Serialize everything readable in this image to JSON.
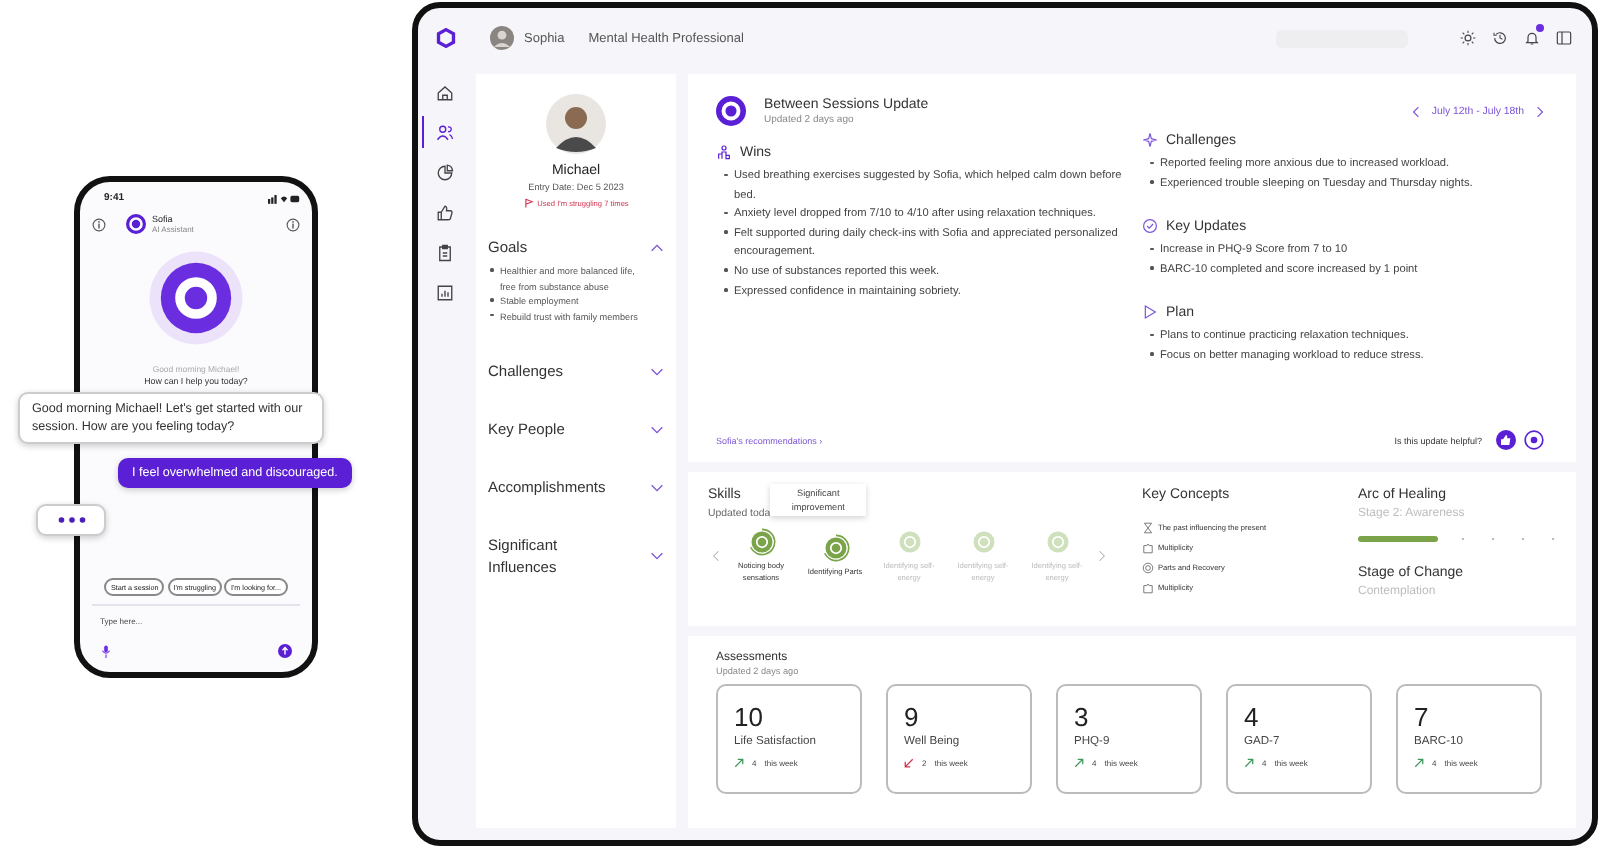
{
  "phone": {
    "time": "9:41",
    "assistant_name": "Sofia",
    "assistant_role": "AI Assistant",
    "greeting": "Good morning Michael!",
    "prompt": "How can I help you today?",
    "chips": [
      "Start a session",
      "I'm struggling",
      "I'm looking for..."
    ],
    "input": {
      "placeholder": "Type here..."
    }
  },
  "chat": [
    {
      "kind": "bot",
      "text": "Good morning Michael! Let's get started with our session.  How are you feeling today?"
    },
    {
      "kind": "user",
      "text": "I feel overwhelmed and discouraged."
    },
    {
      "kind": "typing"
    }
  ],
  "top_bar": {
    "user": "Sophia",
    "role": "Mental Health Professional",
    "notification": true
  },
  "nav_rail": [
    {
      "kind": "home",
      "selected": false
    },
    {
      "kind": "people",
      "selected": true
    },
    {
      "kind": "chart",
      "selected": false
    },
    {
      "kind": "thumbs",
      "selected": false
    },
    {
      "kind": "clipboard",
      "selected": false
    },
    {
      "kind": "report",
      "selected": false
    }
  ],
  "profile": {
    "name": "Michael",
    "entry_date": "Entry Date: Dec 5 2023",
    "alert": "Used I'm struggling 7 times",
    "sections": [
      {
        "title": "Goals",
        "expanded": true,
        "items": [
          "Healthier and more balanced life, free from substance abuse",
          "Stable employment",
          "Rebuild trust with family members"
        ]
      },
      {
        "title": "Challenges",
        "expanded": false
      },
      {
        "title": "Key People",
        "expanded": false
      },
      {
        "title": "Accomplishments",
        "expanded": false
      },
      {
        "title": "Significant Influences",
        "expanded": false
      }
    ]
  },
  "update": {
    "title": "Between Sessions Update",
    "updated": "Updated 2 days ago",
    "date_range": "July 12th - July 18th",
    "sections": [
      {
        "kind": "wins",
        "title": "Wins",
        "items": [
          "Used breathing exercises suggested by Sofia, which helped calm down before bed.",
          "Anxiety level dropped from 7/10 to 4/10 after using relaxation techniques.",
          "Felt supported during daily check-ins with Sofia and appreciated personalized encouragement.",
          "No use of substances reported this week.",
          "Expressed confidence in maintaining sobriety."
        ]
      },
      {
        "kind": "challenges",
        "title": "Challenges",
        "items": [
          "Reported feeling more anxious due to increased workload.",
          "Experienced trouble sleeping on Tuesday and Thursday nights."
        ]
      },
      {
        "kind": "key_updates",
        "title": "Key Updates",
        "items": [
          "Increase in PHQ-9 Score from 7 to 10",
          "BARC-10 completed and score increased by 1 point"
        ]
      },
      {
        "kind": "plan",
        "title": "Plan",
        "items": [
          "Plans to continue practicing relaxation techniques.",
          "Focus on better managing workload to reduce stress."
        ]
      }
    ],
    "recommendations_link": "Sofia's recommendations ›",
    "feedback_prompt": "Is this update helpful?"
  },
  "skills": {
    "title": "Skills",
    "updated": "Updated toda",
    "tooltip": "Significant improvement",
    "items": [
      {
        "label": "Noticing body sensations",
        "achieved": true
      },
      {
        "label": "Identifying Parts",
        "achieved": true
      },
      {
        "label": "Identifying self-energy",
        "achieved": false
      },
      {
        "label": "Identifying self-energy",
        "achieved": false
      },
      {
        "label": "Identifying self-energy",
        "achieved": false
      }
    ]
  },
  "key_concepts": {
    "title": "Key Concepts",
    "items": [
      {
        "kind": "hourglass",
        "label": "The past influencing the present"
      },
      {
        "kind": "puzzle",
        "label": "Multiplicity"
      },
      {
        "kind": "target",
        "label": "Parts and Recovery"
      },
      {
        "kind": "puzzle",
        "label": "Multiplicity"
      }
    ]
  },
  "arc": {
    "title": "Arc of Healing",
    "stage": "Stage 2: Awareness",
    "level": 0.4
  },
  "stage_of_change": {
    "title": "Stage of Change",
    "value": "Contemplation"
  },
  "assessments": {
    "title": "Assessments",
    "updated": "Updated 2 days ago",
    "items": [
      {
        "value": "10",
        "name": "Life Satisfaction",
        "rising": true,
        "delta": "4",
        "period": "this week"
      },
      {
        "value": "9",
        "name": "Well Being",
        "rising": false,
        "delta": "2",
        "period": "this week"
      },
      {
        "value": "3",
        "name": "PHQ-9",
        "rising": true,
        "delta": "4",
        "period": "this week"
      },
      {
        "value": "4",
        "name": "GAD-7",
        "rising": true,
        "delta": "4",
        "period": "this week"
      },
      {
        "value": "7",
        "name": "BARC-10",
        "rising": true,
        "delta": "4",
        "period": "this week"
      }
    ]
  }
}
